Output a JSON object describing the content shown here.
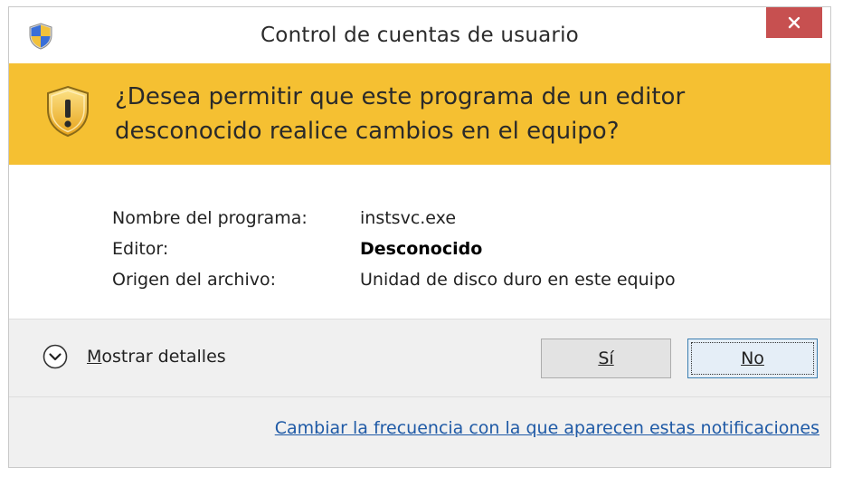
{
  "window": {
    "title": "Control de cuentas de usuario"
  },
  "header": {
    "question": "¿Desea permitir que este programa de un editor desconocido realice cambios en el equipo?"
  },
  "details": {
    "program_label": "Nombre del programa:",
    "program_value": "instsvc.exe",
    "publisher_label": "Editor:",
    "publisher_value": "Desconocido",
    "origin_label": "Origen del archivo:",
    "origin_value": "Unidad de disco duro en este equipo"
  },
  "actions": {
    "show_details_mnemonic": "M",
    "show_details_rest": "ostrar detalles",
    "yes_label": "Sí",
    "no_label": "No"
  },
  "footer": {
    "link_text": "Cambiar la frecuencia con la que aparecen estas notificaciones"
  },
  "colors": {
    "header_bg": "#f5c032",
    "close_bg": "#c75050",
    "link": "#1f5aa6",
    "button_area_bg": "#f0f0f0"
  },
  "icons": {
    "title": "uac-shield-icon",
    "header": "warning-shield-icon",
    "close": "close-icon",
    "expand": "chevron-down-icon"
  }
}
